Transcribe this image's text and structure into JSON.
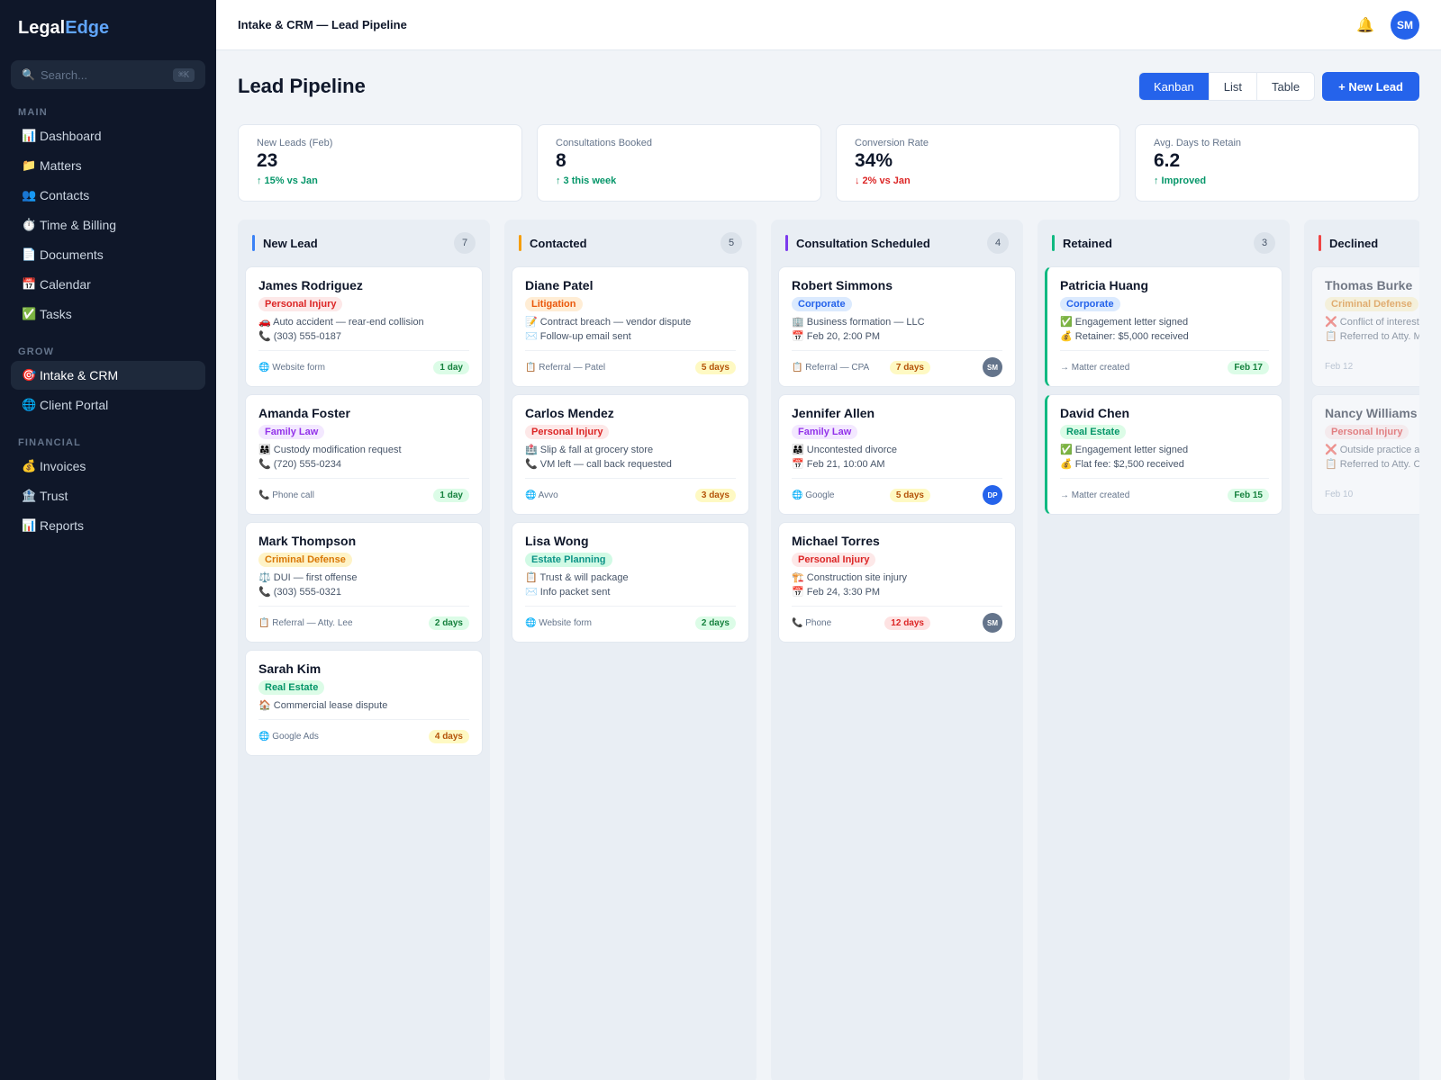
{
  "brand": {
    "part1": "Legal",
    "part2": "Edge"
  },
  "search": {
    "placeholder": "Search...",
    "shortcut": "⌘K"
  },
  "sidebar": {
    "sections": [
      {
        "title": "MAIN",
        "items": [
          {
            "icon": "📊",
            "label": "Dashboard"
          },
          {
            "icon": "📁",
            "label": "Matters"
          },
          {
            "icon": "👥",
            "label": "Contacts"
          },
          {
            "icon": "⏱️",
            "label": "Time & Billing"
          },
          {
            "icon": "📄",
            "label": "Documents"
          },
          {
            "icon": "📅",
            "label": "Calendar"
          },
          {
            "icon": "✅",
            "label": "Tasks"
          }
        ]
      },
      {
        "title": "GROW",
        "items": [
          {
            "icon": "🎯",
            "label": "Intake & CRM",
            "active": true
          },
          {
            "icon": "🌐",
            "label": "Client Portal"
          }
        ]
      },
      {
        "title": "FINANCIAL",
        "items": [
          {
            "icon": "💰",
            "label": "Invoices"
          },
          {
            "icon": "🏦",
            "label": "Trust"
          },
          {
            "icon": "📊",
            "label": "Reports"
          }
        ]
      }
    ]
  },
  "topbar": {
    "breadcrumb": "Intake & CRM — Lead Pipeline",
    "bell_icon": "🔔",
    "user_initials": "SM"
  },
  "page": {
    "title": "Lead Pipeline",
    "views": [
      "Kanban",
      "List",
      "Table"
    ],
    "active_view": "Kanban",
    "new_button": "+ New Lead"
  },
  "stats": [
    {
      "label": "New Leads (Feb)",
      "value": "23",
      "delta": "↑ 15% vs Jan",
      "trend": "up"
    },
    {
      "label": "Consultations Booked",
      "value": "8",
      "delta": "↑ 3 this week",
      "trend": "up"
    },
    {
      "label": "Conversion Rate",
      "value": "34%",
      "delta": "↓ 2% vs Jan",
      "trend": "down"
    },
    {
      "label": "Avg. Days to Retain",
      "value": "6.2",
      "delta": "↑ Improved",
      "trend": "up"
    }
  ],
  "columns": [
    {
      "title": "New Lead",
      "count": "7",
      "color": "#3b82f6",
      "cards": [
        {
          "name": "James Rodriguez",
          "tag": "Personal Injury",
          "tagClass": "pi",
          "lines": [
            "🚗 Auto accident — rear-end collision",
            "📞 (303) 555-0187"
          ],
          "source": "🌐 Website form",
          "pill": "1 day",
          "pillClass": "g"
        },
        {
          "name": "Amanda Foster",
          "tag": "Family Law",
          "tagClass": "fl",
          "lines": [
            "👨‍👩‍👧 Custody modification request",
            "📞 (720) 555-0234"
          ],
          "source": "📞 Phone call",
          "pill": "1 day",
          "pillClass": "g"
        },
        {
          "name": "Mark Thompson",
          "tag": "Criminal Defense",
          "tagClass": "cd",
          "lines": [
            "⚖️ DUI — first offense",
            "📞 (303) 555-0321"
          ],
          "source": "📋 Referral — Atty. Lee",
          "pill": "2 days",
          "pillClass": "g"
        },
        {
          "name": "Sarah Kim",
          "tag": "Real Estate",
          "tagClass": "re",
          "lines": [
            "🏠 Commercial lease dispute"
          ],
          "source": "🌐 Google Ads",
          "pill": "4 days",
          "pillClass": "y"
        }
      ]
    },
    {
      "title": "Contacted",
      "count": "5",
      "color": "#f59e0b",
      "cards": [
        {
          "name": "Diane Patel",
          "tag": "Litigation",
          "tagClass": "lit",
          "lines": [
            "📝 Contract breach — vendor dispute",
            "✉️ Follow-up email sent"
          ],
          "source": "📋 Referral — Patel",
          "pill": "5 days",
          "pillClass": "y"
        },
        {
          "name": "Carlos Mendez",
          "tag": "Personal Injury",
          "tagClass": "pi",
          "lines": [
            "🏥 Slip & fall at grocery store",
            "📞 VM left — call back requested"
          ],
          "source": "🌐 Avvo",
          "pill": "3 days",
          "pillClass": "y"
        },
        {
          "name": "Lisa Wong",
          "tag": "Estate Planning",
          "tagClass": "ep",
          "lines": [
            "📋 Trust & will package",
            "✉️ Info packet sent"
          ],
          "source": "🌐 Website form",
          "pill": "2 days",
          "pillClass": "g"
        }
      ]
    },
    {
      "title": "Consultation Scheduled",
      "count": "4",
      "color": "#7c3aed",
      "cards": [
        {
          "name": "Robert Simmons",
          "tag": "Corporate",
          "tagClass": "corp",
          "lines": [
            "🏢 Business formation — LLC",
            "📅 Feb 20, 2:00 PM"
          ],
          "source": "📋 Referral — CPA",
          "pill": "7 days",
          "pillClass": "y",
          "assignee": "SM",
          "assigneeColor": "#64748b"
        },
        {
          "name": "Jennifer Allen",
          "tag": "Family Law",
          "tagClass": "fl",
          "lines": [
            "👨‍👩‍👧 Uncontested divorce",
            "📅 Feb 21, 10:00 AM"
          ],
          "source": "🌐 Google",
          "pill": "5 days",
          "pillClass": "y",
          "assignee": "DP",
          "assigneeColor": "#2563eb"
        },
        {
          "name": "Michael Torres",
          "tag": "Personal Injury",
          "tagClass": "pi",
          "lines": [
            "🏗️ Construction site injury",
            "📅 Feb 24, 3:30 PM"
          ],
          "source": "📞 Phone",
          "pill": "12 days",
          "pillClass": "r",
          "assignee": "SM",
          "assigneeColor": "#64748b"
        }
      ]
    },
    {
      "title": "Retained",
      "count": "3",
      "color": "#10b981",
      "cards": [
        {
          "name": "Patricia Huang",
          "tag": "Corporate",
          "tagClass": "corp",
          "lines": [
            "✅ Engagement letter signed",
            "💰 Retainer: $5,000 received"
          ],
          "source": "→ Matter created",
          "pill": "Feb 17",
          "pillClass": "g",
          "won": true
        },
        {
          "name": "David Chen",
          "tag": "Real Estate",
          "tagClass": "re",
          "lines": [
            "✅ Engagement letter signed",
            "💰 Flat fee: $2,500 received"
          ],
          "source": "→ Matter created",
          "pill": "Feb 15",
          "pillClass": "g",
          "won": true
        }
      ]
    },
    {
      "title": "Declined",
      "count": "",
      "color": "#ef4444",
      "cards": [
        {
          "name": "Thomas Burke",
          "tag": "Criminal Defense",
          "tagClass": "cd",
          "lines": [
            "❌ Conflict of interest",
            "📋 Referred to Atty. M"
          ],
          "date": "Feb 12",
          "faded": true
        },
        {
          "name": "Nancy Williams",
          "tag": "Personal Injury",
          "tagClass": "pi",
          "lines": [
            "❌ Outside practice a",
            "📋 Referred to Atty. C"
          ],
          "date": "Feb 10",
          "faded": true
        }
      ]
    }
  ]
}
